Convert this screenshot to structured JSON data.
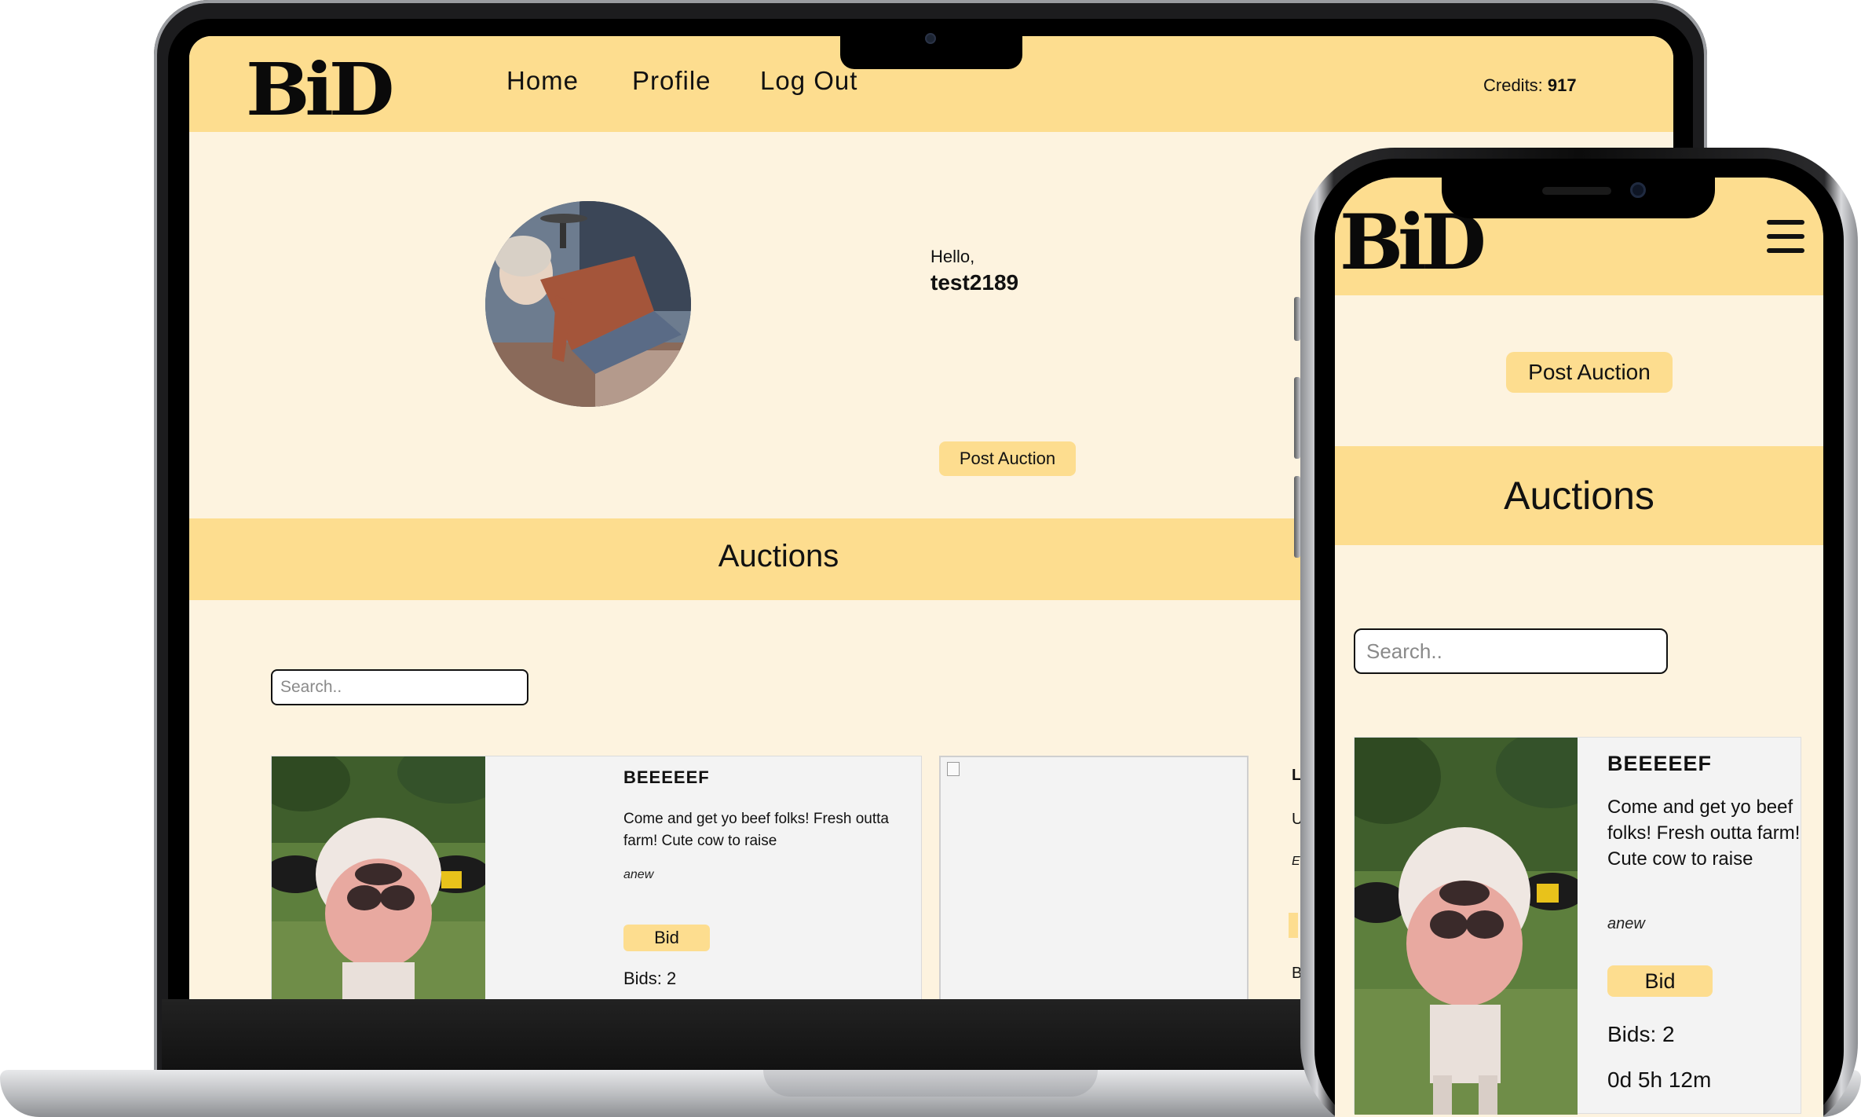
{
  "brand": {
    "logo": "BiD"
  },
  "nav": {
    "items": [
      "Home",
      "Profile",
      "Log Out"
    ],
    "credits_label": "Credits:",
    "credits_value": "917"
  },
  "profile": {
    "greeting": "Hello,",
    "username": "test2189",
    "post_auction_label": "Post Auction"
  },
  "auctions": {
    "heading": "Auctions",
    "search_placeholder": "Search..",
    "cards": [
      {
        "title": "BEEEEEF",
        "description": "Come and get yo beef folks! Fresh outta farm! Cute cow to raise",
        "seller": "anew",
        "bid_label": "Bid",
        "bids_text": "Bids: 2",
        "time_left": "0d 5h 12m"
      }
    ],
    "partial_card_letters": [
      "L",
      "U",
      "E",
      "B"
    ]
  },
  "colors": {
    "header_bg": "#fddd8f",
    "page_bg": "#fdf3df",
    "card_bg": "#f3f3f3",
    "text": "#111111"
  },
  "icons": [
    "hamburger-menu-icon",
    "broken-image-icon"
  ]
}
